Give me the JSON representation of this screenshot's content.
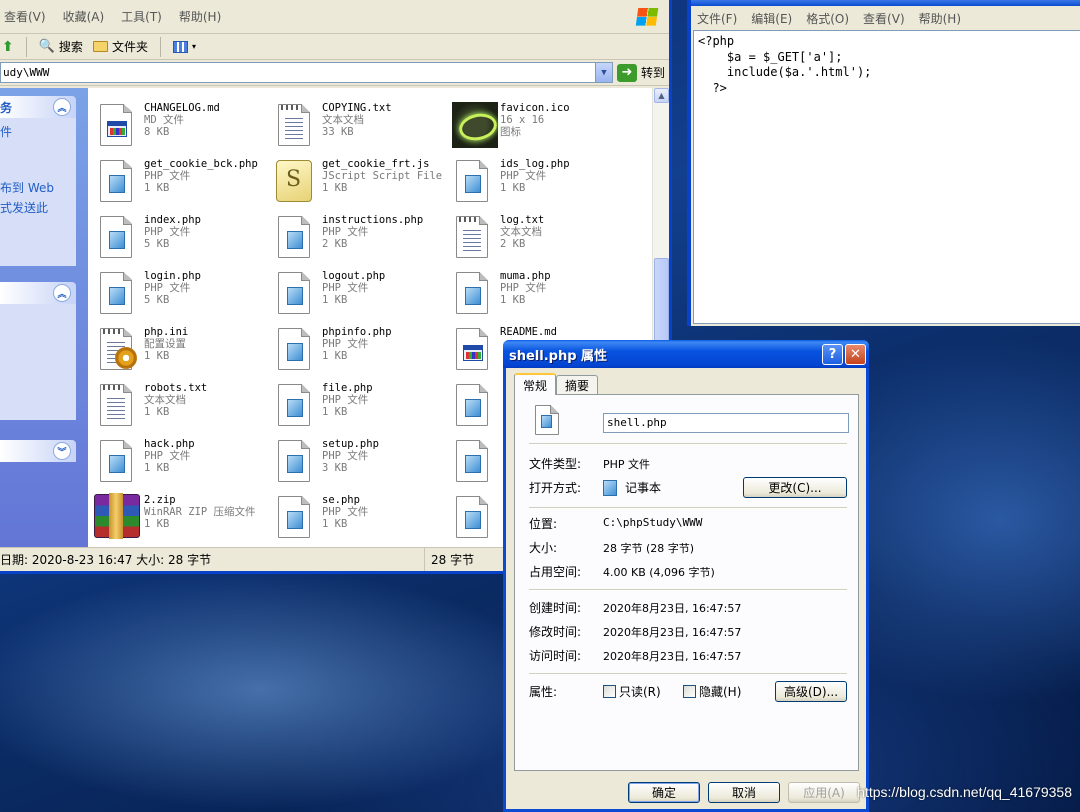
{
  "explorer": {
    "menu": [
      "查看(V)",
      "收藏(A)",
      "工具(T)",
      "帮助(H)"
    ],
    "toolbar": {
      "search": "搜索",
      "folders": "文件夹"
    },
    "address": "udy\\WWW",
    "go_label": "转到",
    "taskpane": {
      "group1_title": "务",
      "group1_links": [
        "件",
        "布到 Web",
        "式发送此"
      ]
    },
    "files": [
      {
        "name": "CHANGELOG.md",
        "type": "MD 文件",
        "size": "8 KB",
        "icon": "md-icon"
      },
      {
        "name": "COPYING.txt",
        "type": "文本文档",
        "size": "33 KB",
        "icon": "txt-icon"
      },
      {
        "name": "favicon.ico",
        "type": "16 x 16",
        "size": "图标",
        "icon": "ico-icon"
      },
      {
        "name": "get_cookie_bck.php",
        "type": "PHP 文件",
        "size": "1 KB",
        "icon": "php-icon"
      },
      {
        "name": "get_cookie_frt.js",
        "type": "JScript Script File",
        "size": "1 KB",
        "icon": "js-icon"
      },
      {
        "name": "ids_log.php",
        "type": "PHP 文件",
        "size": "1 KB",
        "icon": "php-icon"
      },
      {
        "name": "index.php",
        "type": "PHP 文件",
        "size": "5 KB",
        "icon": "php-icon"
      },
      {
        "name": "instructions.php",
        "type": "PHP 文件",
        "size": "2 KB",
        "icon": "php-icon"
      },
      {
        "name": "log.txt",
        "type": "文本文档",
        "size": "2 KB",
        "icon": "txt-icon"
      },
      {
        "name": "login.php",
        "type": "PHP 文件",
        "size": "5 KB",
        "icon": "php-icon"
      },
      {
        "name": "logout.php",
        "type": "PHP 文件",
        "size": "1 KB",
        "icon": "php-icon"
      },
      {
        "name": "muma.php",
        "type": "PHP 文件",
        "size": "1 KB",
        "icon": "php-icon"
      },
      {
        "name": "php.ini",
        "type": "配置设置",
        "size": "1 KB",
        "icon": "ini-icon"
      },
      {
        "name": "phpinfo.php",
        "type": "PHP 文件",
        "size": "1 KB",
        "icon": "php-icon"
      },
      {
        "name": "README.md",
        "type": "",
        "size": "",
        "icon": "md-icon"
      },
      {
        "name": "robots.txt",
        "type": "文本文档",
        "size": "1 KB",
        "icon": "txt-icon"
      },
      {
        "name": "file.php",
        "type": "PHP 文件",
        "size": "1 KB",
        "icon": "php-icon"
      },
      {
        "name": "",
        "type": "",
        "size": "",
        "icon": "php-icon"
      },
      {
        "name": "hack.php",
        "type": "PHP 文件",
        "size": "1 KB",
        "icon": "php-icon"
      },
      {
        "name": "setup.php",
        "type": "PHP 文件",
        "size": "3 KB",
        "icon": "php-icon"
      },
      {
        "name": "",
        "type": "",
        "size": "",
        "icon": "php-icon"
      },
      {
        "name": "2.zip",
        "type": "WinRAR ZIP 压缩文件",
        "size": "1 KB",
        "icon": "rar-icon"
      },
      {
        "name": "se.php",
        "type": "PHP 文件",
        "size": "1 KB",
        "icon": "php-icon"
      },
      {
        "name": "",
        "type": "",
        "size": "",
        "icon": "php-icon"
      }
    ],
    "status_left": "日期: 2020-8-23 16:47 大小: 28 字节",
    "status_right": "28 字节"
  },
  "notepad": {
    "menu": [
      "文件(F)",
      "编辑(E)",
      "格式(O)",
      "查看(V)",
      "帮助(H)"
    ],
    "content": "<?php\n    $a = $_GET['a'];\n    include($a.'.html');\n  ?>"
  },
  "dialog": {
    "title": "shell.php 属性",
    "tabs": [
      "常规",
      "摘要"
    ],
    "filename": "shell.php",
    "type_label": "文件类型:",
    "type_value": "PHP 文件",
    "open_label": "打开方式:",
    "open_value": "记事本",
    "change_btn": "更改(C)...",
    "location_label": "位置:",
    "location_value": "C:\\phpStudy\\WWW",
    "size_label": "大小:",
    "size_value": "28 字节 (28 字节)",
    "disk_label": "占用空间:",
    "disk_value": "4.00 KB (4,096 字节)",
    "created_label": "创建时间:",
    "created_value": "2020年8月23日, 16:47:57",
    "modified_label": "修改时间:",
    "modified_value": "2020年8月23日, 16:47:57",
    "accessed_label": "访问时间:",
    "accessed_value": "2020年8月23日, 16:47:57",
    "attr_label": "属性:",
    "readonly_label": "只读(R)",
    "hidden_label": "隐藏(H)",
    "advanced_btn": "高级(D)...",
    "ok_btn": "确定",
    "cancel_btn": "取消",
    "apply_btn": "应用(A)"
  },
  "watermark": "https://blog.csdn.net/qq_41679358"
}
